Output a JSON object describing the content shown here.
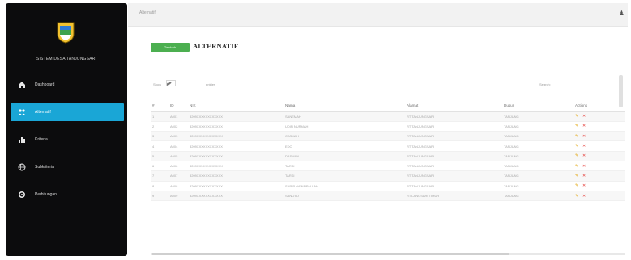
{
  "sidebar": {
    "brand": "SISTEM DESA TANJUNGSARI",
    "items": [
      {
        "label": "Dashboard",
        "icon": "home-icon"
      },
      {
        "label": "Alternatif",
        "icon": "users-icon"
      },
      {
        "label": "Kriteria",
        "icon": "bar-chart-icon"
      },
      {
        "label": "Subkriteria",
        "icon": "globe-icon"
      },
      {
        "label": "Perhitungan",
        "icon": "gear-icon"
      }
    ],
    "accent": "#1aa6d6"
  },
  "topbar": {
    "breadcrumb": "Alternatif",
    "user_glyph": "♟"
  },
  "main": {
    "add_button": "Tambah",
    "title": "ALTERNATIF",
    "show_label": "Show",
    "show_value": "10",
    "entries_label": "entries",
    "search_label": "Search:",
    "columns": [
      "#",
      "ID",
      "NIK",
      "Nama",
      "Alamat",
      "Dusun",
      "Actions"
    ],
    "rows": [
      [
        "1",
        "A001",
        "3209XXXXXXXXXXXX",
        "SANEMAH",
        "RT TANJUNGSARI",
        "TANJUNG",
        ""
      ],
      [
        "2",
        "A002",
        "3209XXXXXXXXXXXX",
        "UDIN NURMAH",
        "RT TANJUNGSARI",
        "TANJUNG",
        ""
      ],
      [
        "3",
        "A003",
        "3209XXXXXXXXXXXX",
        "CASMAH",
        "RT TANJUNGSARI",
        "TANJUNG",
        ""
      ],
      [
        "4",
        "A004",
        "3209XXXXXXXXXXXX",
        "EDO",
        "RT TANJUNGSARI",
        "TANJUNG",
        ""
      ],
      [
        "5",
        "A005",
        "3209XXXXXXXXXXXX",
        "DASMAN",
        "RT TANJUNGSARI",
        "TANJUNG",
        ""
      ],
      [
        "6",
        "A006",
        "3209XXXXXXXXXXXX",
        "TARSI",
        "RT TANJUNGSARI",
        "TANJUNG",
        ""
      ],
      [
        "7",
        "A007",
        "3209XXXXXXXXXXXX",
        "TARSI",
        "RT TANJUNGSARI",
        "TANJUNG",
        ""
      ],
      [
        "8",
        "A008",
        "3209XXXXXXXXXXXX",
        "SARIP NAWAIPALLAH",
        "RT TANJUNGSARI",
        "TANJUNG",
        ""
      ],
      [
        "9",
        "A009",
        "3209XXXXXXXXXXXX",
        "SANOTO",
        "RT LANGSARI TIMUR",
        "TANJUNG",
        ""
      ]
    ]
  },
  "colors": {
    "add_button": "#4caf50",
    "edit_icon": "#e0a000",
    "delete_icon": "#e53935"
  }
}
